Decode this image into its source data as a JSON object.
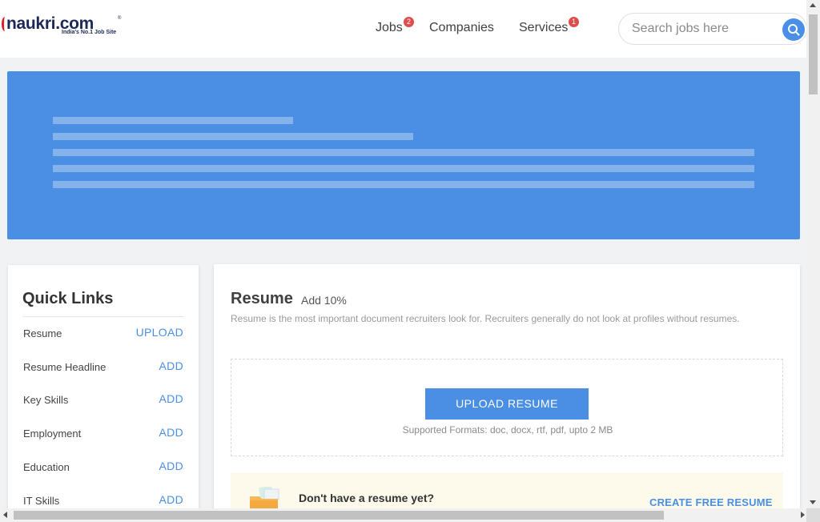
{
  "header": {
    "logo": {
      "brand": "naukri.com",
      "tagline": "India's No.1 Job Site",
      "reg_mark": "®"
    },
    "nav": [
      {
        "label": "Jobs",
        "badge": "2"
      },
      {
        "label": "Companies"
      },
      {
        "label": "Services",
        "badge": "1"
      }
    ],
    "search": {
      "placeholder": "Search jobs here",
      "value": "",
      "icon": "search-icon"
    }
  },
  "colors": {
    "accent": "#4a8fe3",
    "badge": "#e04c4c",
    "cta_bg": "#fdfaeb"
  },
  "banner": {
    "state": "loading-skeleton"
  },
  "quick_links": {
    "title": "Quick Links",
    "items": [
      {
        "label": "Resume",
        "action": "UPLOAD"
      },
      {
        "label": "Resume Headline",
        "action": "ADD"
      },
      {
        "label": "Key Skills",
        "action": "ADD"
      },
      {
        "label": "Employment",
        "action": "ADD"
      },
      {
        "label": "Education",
        "action": "ADD"
      },
      {
        "label": "IT Skills",
        "action": "ADD"
      }
    ]
  },
  "resume": {
    "title": "Resume",
    "add_label": "Add 10%",
    "description": "Resume is the most important document recruiters look for. Recruiters generally do not look at profiles without resumes.",
    "upload_button": "UPLOAD RESUME",
    "formats": "Supported Formats: doc, docx, rtf, pdf, upto 2 MB",
    "cta": {
      "text": "Don't have a resume yet?",
      "link": "CREATE FREE RESUME"
    }
  }
}
